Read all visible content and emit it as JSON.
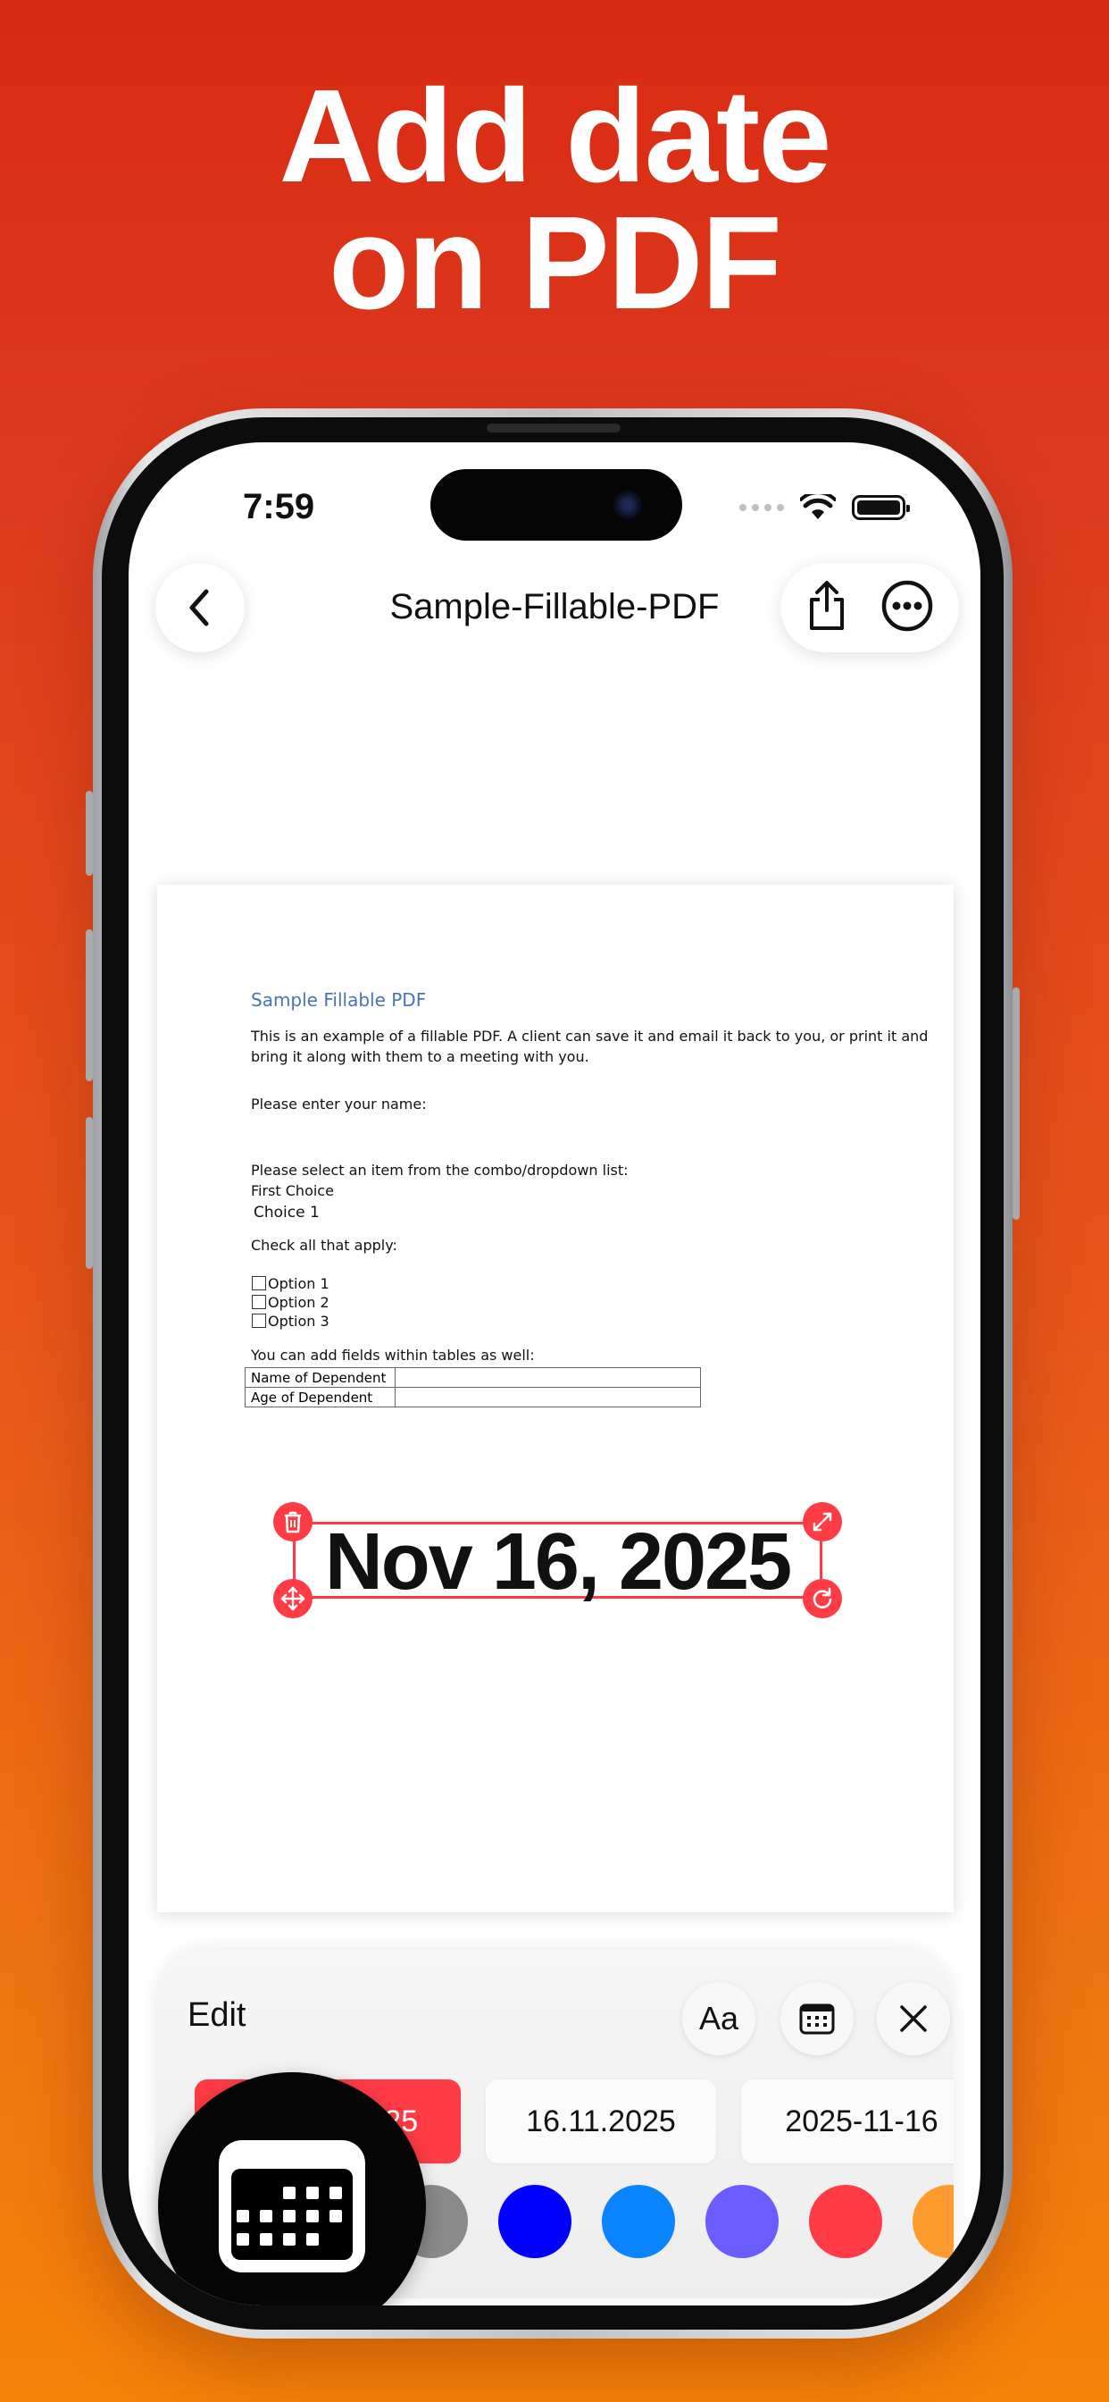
{
  "headline": {
    "line1": "Add date",
    "line2": "on PDF"
  },
  "status_bar": {
    "time": "7:59"
  },
  "nav": {
    "title": "Sample-Fillable-PDF"
  },
  "pdf": {
    "heading": "Sample Fillable PDF",
    "intro_line1": "This is an example of a fillable PDF. A client can save it and email it back to you, or print it and",
    "intro_line2": "bring it along with them to a meeting with you.",
    "name_prompt": "Please enter your name:",
    "combo_prompt": "Please select an item from the combo/dropdown list:",
    "combo_label": "First Choice",
    "combo_value": "Choice 1",
    "check_prompt": "Check all that apply:",
    "options": [
      "Option 1",
      "Option 2",
      "Option 3"
    ],
    "table_prompt": "You can add  fields within tables as well:",
    "table_rows": [
      "Name of Dependent",
      "Age of Dependent"
    ],
    "date_stamp": "Nov 16, 2025"
  },
  "sheet": {
    "edit_label": "Edit",
    "font_button": "Aa",
    "formats": [
      "Nov 16, 2025",
      "16.11.2025",
      "2025-11-16"
    ],
    "selected_format": 0,
    "colors": [
      "#000000",
      "#555555",
      "#8a8a8a",
      "#0000ff",
      "#0a84ff",
      "#6a5cff",
      "#ff3b45",
      "#ff9a2e"
    ],
    "selected_color": 0
  }
}
